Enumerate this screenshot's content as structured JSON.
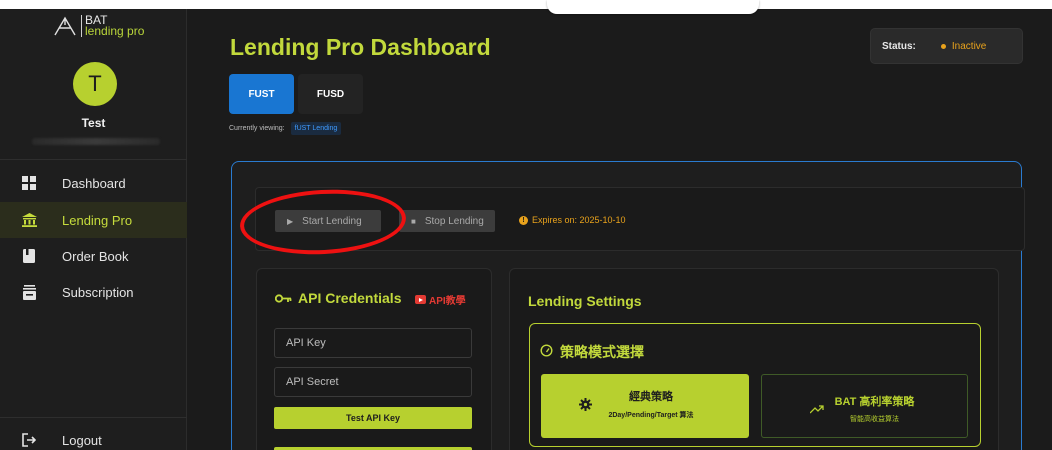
{
  "brand": {
    "logo_top": "BAT",
    "logo_bottom": "lending pro"
  },
  "user": {
    "initial": "T",
    "name": "Test"
  },
  "sidebar": {
    "items": [
      {
        "label": "Dashboard",
        "icon": "dashboard-icon"
      },
      {
        "label": "Lending Pro",
        "icon": "bank-icon",
        "active": true
      },
      {
        "label": "Order Book",
        "icon": "book-icon"
      },
      {
        "label": "Subscription",
        "icon": "subscription-icon"
      }
    ],
    "logout": "Logout"
  },
  "header": {
    "title": "Lending Pro Dashboard",
    "status_label": "Status:",
    "status_value": "Inactive",
    "status_color": "#e8a21c"
  },
  "tabs": [
    {
      "label": "FUST",
      "active": true
    },
    {
      "label": "FUSD",
      "active": false
    }
  ],
  "viewing": {
    "label": "Currently viewing:",
    "value": "fUST Lending"
  },
  "controls": {
    "start_label": "Start Lending",
    "stop_label": "Stop Lending",
    "expires": "Expires on: 2025-10-10"
  },
  "api": {
    "title": "API Credentials",
    "tutorial_label": "API教學",
    "key_placeholder": "API Key",
    "secret_placeholder": "API Secret",
    "test_label": "Test API Key"
  },
  "settings": {
    "title": "Lending Settings",
    "strategy_title": "策略模式選擇",
    "options": [
      {
        "name": "經典策略",
        "sub": "2Day/Pending/Target 算法",
        "selected": true
      },
      {
        "name": "BAT 高利率策略",
        "sub": "智能高收益算法",
        "selected": false
      }
    ]
  },
  "colors": {
    "accent": "#b7d02f",
    "primary": "#1976d2",
    "warning": "#e8a21c"
  }
}
